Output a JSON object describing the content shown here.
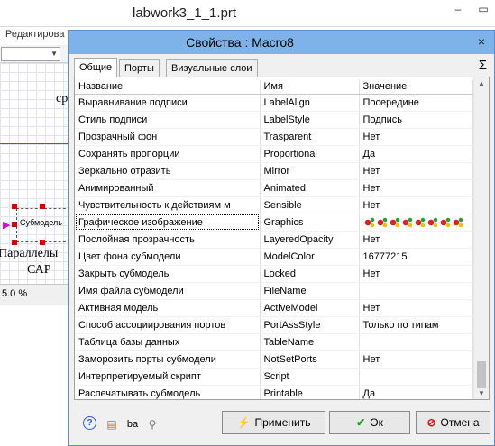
{
  "main_window": {
    "title": "labwork3_1_1.prt",
    "menu_partial": "Редактирова",
    "status_zoom": "5.0 %",
    "canvas_text": {
      "top": "ср",
      "submodel_label": "Субмодель",
      "caption_line1": "Параллелы",
      "caption_line2": "САР"
    }
  },
  "dialog": {
    "title": "Свойства :   Macro8",
    "close_glyph": "×",
    "tabs": [
      "Общие",
      "Порты",
      "Визуальные слои"
    ],
    "sigma": "Σ",
    "columns": [
      "Название",
      "Имя",
      "Значение"
    ],
    "rows": [
      {
        "label": "Выравнивание подписи",
        "name": "LabelAlign",
        "value": "Посередине"
      },
      {
        "label": "Стиль подписи",
        "name": "LabelStyle",
        "value": "Подпись"
      },
      {
        "label": "Прозрачный фон",
        "name": "Trasparent",
        "value": "Нет"
      },
      {
        "label": "Сохранять пропорции",
        "name": "Proportional",
        "value": "Да"
      },
      {
        "label": "Зеркально отразить",
        "name": "Mirror",
        "value": "Нет"
      },
      {
        "label": "Анимированный",
        "name": "Animated",
        "value": "Нет"
      },
      {
        "label": "Чувствительность к действиям м",
        "name": "Sensible",
        "value": "Нет"
      },
      {
        "label": "Графическое изображение",
        "name": "Graphics",
        "value": ""
      },
      {
        "label": "Послойная прозрачность",
        "name": "LayeredOpacity",
        "value": "Нет"
      },
      {
        "label": "Цвет фона субмодели",
        "name": "ModelColor",
        "value": "16777215"
      },
      {
        "label": "Закрыть субмодель",
        "name": "Locked",
        "value": "Нет"
      },
      {
        "label": "Имя файла субмодели",
        "name": "FileName",
        "value": ""
      },
      {
        "label": "Активная модель",
        "name": "ActiveModel",
        "value": "Нет"
      },
      {
        "label": "Способ ассоциирования портов",
        "name": "PortAssStyle",
        "value": "Только по типам"
      },
      {
        "label": "Таблица базы данных",
        "name": "TableName",
        "value": ""
      },
      {
        "label": "Заморозить порты субмодели",
        "name": "NotSetPorts",
        "value": "Нет"
      },
      {
        "label": "Интерпретируемый скрипт",
        "name": "Script",
        "value": ""
      },
      {
        "label": "Распечатывать субмодель",
        "name": "Printable",
        "value": "Да"
      }
    ],
    "buttons": {
      "apply": "Применить",
      "ok": "Ок",
      "cancel": "Отмена"
    },
    "icons": [
      "help-icon",
      "properties-icon",
      "rename-icon",
      "search-icon"
    ]
  },
  "colors": {
    "dialog_title_bg": "#7db3e8",
    "magenta_line": "#e000e0",
    "selection_handle": "#e00000"
  }
}
